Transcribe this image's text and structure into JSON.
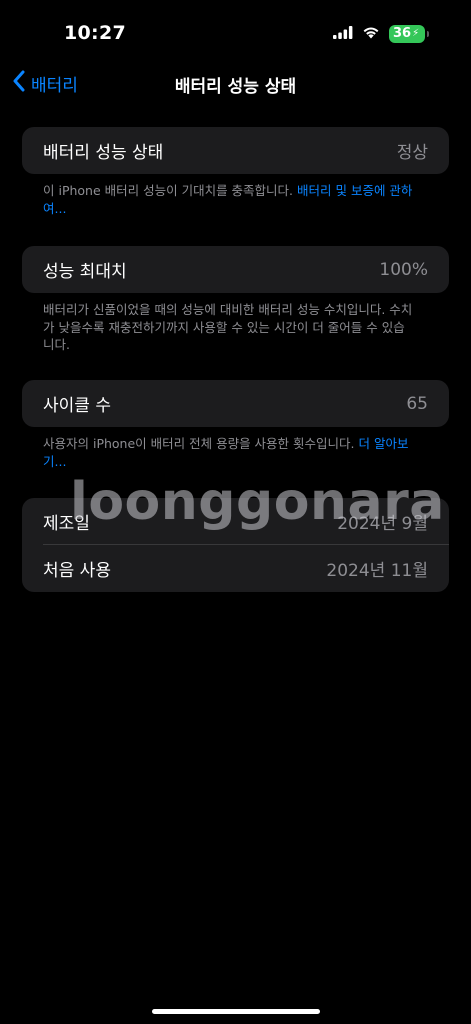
{
  "status_bar": {
    "time": "10:27",
    "battery_level": "36",
    "battery_color": "#34c759",
    "signal_icon": "cellular-signal-icon",
    "wifi_icon": "wifi-icon",
    "charging_icon": "charging-bolt-icon"
  },
  "nav": {
    "back_label": "배터리",
    "title": "배터리 성능 상태",
    "accent_color": "#0a84ff"
  },
  "health": {
    "label": "배터리 성능 상태",
    "value": "정상",
    "footer_text": "이 iPhone 배터리 성능이 기대치를 충족합니다. ",
    "footer_link": "배터리 및 보증에 관하여..."
  },
  "max_capacity": {
    "label": "성능 최대치",
    "value": "100%",
    "footer_text": "배터리가 신품이었을 때의 성능에 대비한 배터리 성능 수치입니다. 수치가 낮을수록 재충전하기까지 사용할 수 있는 시간이 더 줄어들 수 있습니다."
  },
  "cycle_count": {
    "label": "사이클 수",
    "value": "65",
    "footer_text": "사용자의 iPhone이 배터리 전체 용량을 사용한 횟수입니다. ",
    "footer_link": "더 알아보기..."
  },
  "dates": {
    "manufacture_label": "제조일",
    "manufacture_value": "2024년 9월",
    "first_use_label": "처음 사용",
    "first_use_value": "2024년 11월"
  },
  "watermark": "loonggonara"
}
